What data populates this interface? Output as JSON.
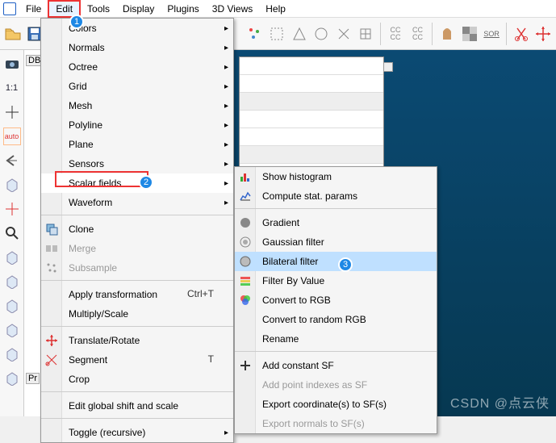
{
  "menubar": {
    "items": [
      "File",
      "Edit",
      "Tools",
      "Display",
      "Plugins",
      "3D Views",
      "Help"
    ],
    "selected_index": 1
  },
  "leftbar": {
    "ratio": "1:1",
    "auto": "auto"
  },
  "panels": {
    "db": "DB",
    "props": "Pr"
  },
  "edit_menu": {
    "items": [
      {
        "label": "Colors",
        "sub": true
      },
      {
        "label": "Normals",
        "sub": true
      },
      {
        "label": "Octree",
        "sub": true
      },
      {
        "label": "Grid",
        "sub": true
      },
      {
        "label": "Mesh",
        "sub": true
      },
      {
        "label": "Polyline",
        "sub": true
      },
      {
        "label": "Plane",
        "sub": true
      },
      {
        "label": "Sensors",
        "sub": true
      },
      {
        "label": "Scalar fields",
        "sub": true,
        "hl": true
      },
      {
        "label": "Waveform",
        "sub": true
      },
      {
        "sep": true
      },
      {
        "label": "Clone",
        "icon": "clone"
      },
      {
        "label": "Merge",
        "icon": "merge",
        "disabled": true
      },
      {
        "label": "Subsample",
        "icon": "subsample",
        "disabled": true
      },
      {
        "sep": true
      },
      {
        "label": "Apply transformation",
        "hot": "Ctrl+T"
      },
      {
        "label": "Multiply/Scale"
      },
      {
        "sep": true
      },
      {
        "label": "Translate/Rotate",
        "icon": "move"
      },
      {
        "label": "Segment",
        "icon": "segment",
        "hot": "T"
      },
      {
        "label": "Crop"
      },
      {
        "sep": true
      },
      {
        "label": "Edit global shift and scale"
      },
      {
        "sep": true
      },
      {
        "label": "Toggle (recursive)",
        "sub": true
      }
    ]
  },
  "sf_menu": {
    "items": [
      {
        "label": "Show histogram",
        "icon": "histogram"
      },
      {
        "label": "Compute stat. params",
        "icon": "stats"
      },
      {
        "sep": true
      },
      {
        "label": "Gradient",
        "icon": "gradient"
      },
      {
        "label": "Gaussian filter",
        "icon": "gaussian"
      },
      {
        "label": "Bilateral filter",
        "icon": "bilateral",
        "hl": true
      },
      {
        "label": "Filter By Value",
        "icon": "filterval"
      },
      {
        "label": "Convert to RGB",
        "icon": "rgb"
      },
      {
        "label": "Convert to random RGB"
      },
      {
        "label": "Rename"
      },
      {
        "sep": true
      },
      {
        "label": "Add constant SF",
        "icon": "plus"
      },
      {
        "label": "Add point indexes as SF",
        "disabled": true
      },
      {
        "label": "Export coordinate(s) to SF(s)"
      },
      {
        "label": "Export normals to SF(s)",
        "disabled": true
      }
    ]
  },
  "badges": {
    "b1": "1",
    "b2": "2",
    "b3": "3"
  },
  "watermark": "CSDN @点云侠"
}
